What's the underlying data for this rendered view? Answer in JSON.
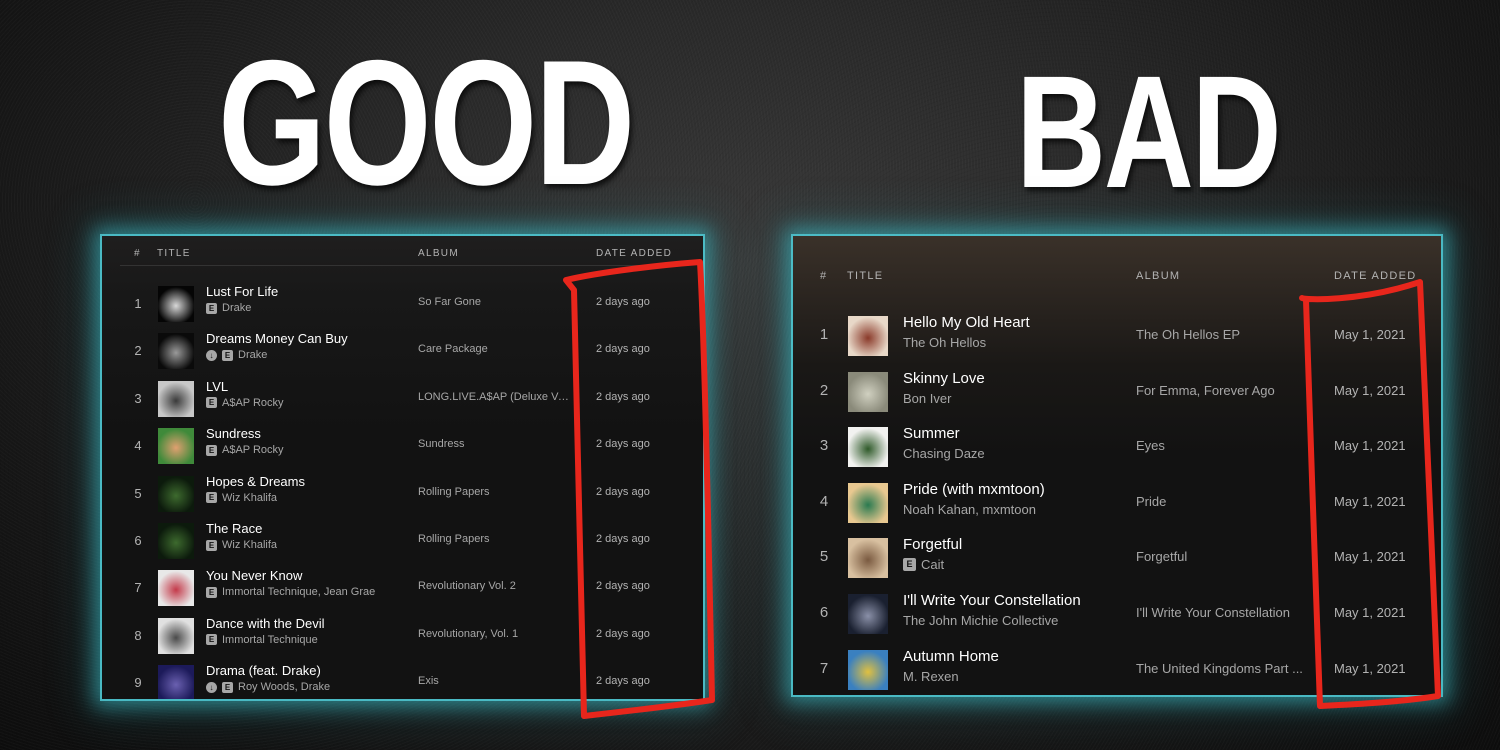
{
  "headings": {
    "good": "GOOD",
    "bad": "BAD"
  },
  "colors": {
    "glow": "#3cbec8",
    "annotation": "#e8261c",
    "text_primary": "#ffffff",
    "text_secondary": "#a7a7a7"
  },
  "good_panel": {
    "columns": {
      "num": "#",
      "title": "Title",
      "album": "Album",
      "date": "Date Added"
    },
    "tracks": [
      {
        "num": "1",
        "title": "Lust For Life",
        "artist": "Drake",
        "explicit": true,
        "downloaded": false,
        "album": "So Far Gone",
        "date": "2 days ago",
        "art": [
          "#050505",
          "#d8d8d8"
        ]
      },
      {
        "num": "2",
        "title": "Dreams Money Can Buy",
        "artist": "Drake",
        "explicit": true,
        "downloaded": true,
        "album": "Care Package",
        "date": "2 days ago",
        "art": [
          "#0a0a0a",
          "#9a9a9a"
        ]
      },
      {
        "num": "3",
        "title": "LVL",
        "artist": "A$AP Rocky",
        "explicit": true,
        "downloaded": false,
        "album": "LONG.LIVE.A$AP (Deluxe Version)",
        "date": "2 days ago",
        "art": [
          "#c8c8c8",
          "#3a3a3a"
        ]
      },
      {
        "num": "4",
        "title": "Sundress",
        "artist": "A$AP Rocky",
        "explicit": true,
        "downloaded": false,
        "album": "Sundress",
        "date": "2 days ago",
        "art": [
          "#3f8a3a",
          "#e0a070"
        ]
      },
      {
        "num": "5",
        "title": "Hopes & Dreams",
        "artist": "Wiz Khalifa",
        "explicit": true,
        "downloaded": false,
        "album": "Rolling Papers",
        "date": "2 days ago",
        "art": [
          "#0c1a0c",
          "#3d6a2e"
        ]
      },
      {
        "num": "6",
        "title": "The Race",
        "artist": "Wiz Khalifa",
        "explicit": true,
        "downloaded": false,
        "album": "Rolling Papers",
        "date": "2 days ago",
        "art": [
          "#0c1a0c",
          "#3d6a2e"
        ]
      },
      {
        "num": "7",
        "title": "You Never Know",
        "artist": "Immortal Technique, Jean Grae",
        "explicit": true,
        "downloaded": false,
        "album": "Revolutionary Vol. 2",
        "date": "2 days ago",
        "art": [
          "#e8e8e8",
          "#c43a4a"
        ]
      },
      {
        "num": "8",
        "title": "Dance with the Devil",
        "artist": "Immortal Technique",
        "explicit": true,
        "downloaded": false,
        "album": "Revolutionary, Vol. 1",
        "date": "2 days ago",
        "art": [
          "#e0e0e0",
          "#4a4a4a"
        ]
      },
      {
        "num": "9",
        "title": "Drama (feat. Drake)",
        "artist": "Roy Woods, Drake",
        "explicit": true,
        "downloaded": true,
        "album": "Exis",
        "date": "2 days ago",
        "art": [
          "#1c1a5a",
          "#6a60b0"
        ]
      }
    ]
  },
  "bad_panel": {
    "columns": {
      "num": "#",
      "title": "Title",
      "album": "Album",
      "date": "Date Added"
    },
    "tracks": [
      {
        "num": "1",
        "title": "Hello My Old Heart",
        "artist": "The Oh Hellos",
        "explicit": false,
        "album": "The Oh Hellos EP",
        "date": "May 1, 2021",
        "art": [
          "#e8d8c8",
          "#8a3a2a"
        ]
      },
      {
        "num": "2",
        "title": "Skinny Love",
        "artist": "Bon Iver",
        "explicit": false,
        "album": "For Emma, Forever Ago",
        "date": "May 1, 2021",
        "art": [
          "#8a8a7a",
          "#d0d0c0"
        ]
      },
      {
        "num": "3",
        "title": "Summer",
        "artist": "Chasing Daze",
        "explicit": false,
        "album": "Eyes",
        "date": "May 1, 2021",
        "art": [
          "#f2f2f0",
          "#2f5a2a"
        ]
      },
      {
        "num": "4",
        "title": "Pride (with mxmtoon)",
        "artist": "Noah Kahan, mxmtoon",
        "explicit": false,
        "album": "Pride",
        "date": "May 1, 2021",
        "art": [
          "#e8c890",
          "#2a7a50"
        ]
      },
      {
        "num": "5",
        "title": "Forgetful",
        "artist": "Cait",
        "explicit": true,
        "album": "Forgetful",
        "date": "May 1, 2021",
        "art": [
          "#d8c0a0",
          "#7a5a40"
        ]
      },
      {
        "num": "6",
        "title": "I'll Write Your Constellation",
        "artist": "The John Michie Collective",
        "explicit": false,
        "album": "I'll Write Your Constellation",
        "date": "May 1, 2021",
        "art": [
          "#1a2030",
          "#8a90a8"
        ]
      },
      {
        "num": "7",
        "title": "Autumn Home",
        "artist": "M. Rexen",
        "explicit": false,
        "album": "The United Kingdoms Part ...",
        "date": "May 1, 2021",
        "art": [
          "#3a80c0",
          "#e0c040"
        ]
      }
    ]
  }
}
